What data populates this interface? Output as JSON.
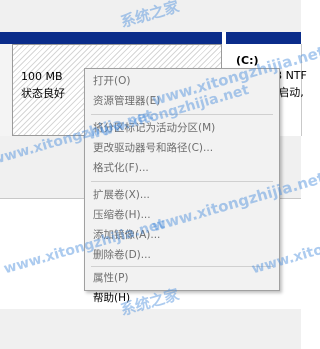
{
  "disk": {
    "part1": {
      "size": "100 MB",
      "status": "状态良好"
    },
    "part2": {
      "name": "(C:)",
      "size": "GB NTF",
      "status": "(启动,",
      "prefix": "5"
    }
  },
  "context_menu": {
    "items": [
      {
        "label": "打开(O)",
        "enabled": false
      },
      {
        "label": "资源管理器(E)",
        "enabled": false
      },
      {
        "label": "将分区标记为活动分区(M)",
        "enabled": false
      },
      {
        "label": "更改驱动器号和路径(C)...",
        "enabled": false
      },
      {
        "label": "格式化(F)...",
        "enabled": false
      },
      {
        "label": "扩展卷(X)...",
        "enabled": false
      },
      {
        "label": "压缩卷(H)...",
        "enabled": false
      },
      {
        "label": "添加镜像(A)...",
        "enabled": false
      },
      {
        "label": "删除卷(D)...",
        "enabled": false
      },
      {
        "label": "属性(P)",
        "enabled": false
      },
      {
        "label": "帮助(H)",
        "enabled": true
      }
    ]
  },
  "watermarks": {
    "brand_cn": "系统之家",
    "url": "www.xitongzhijia.net"
  },
  "colors": {
    "disk_band": "#0a2c8a",
    "watermark": "#468cdc"
  }
}
